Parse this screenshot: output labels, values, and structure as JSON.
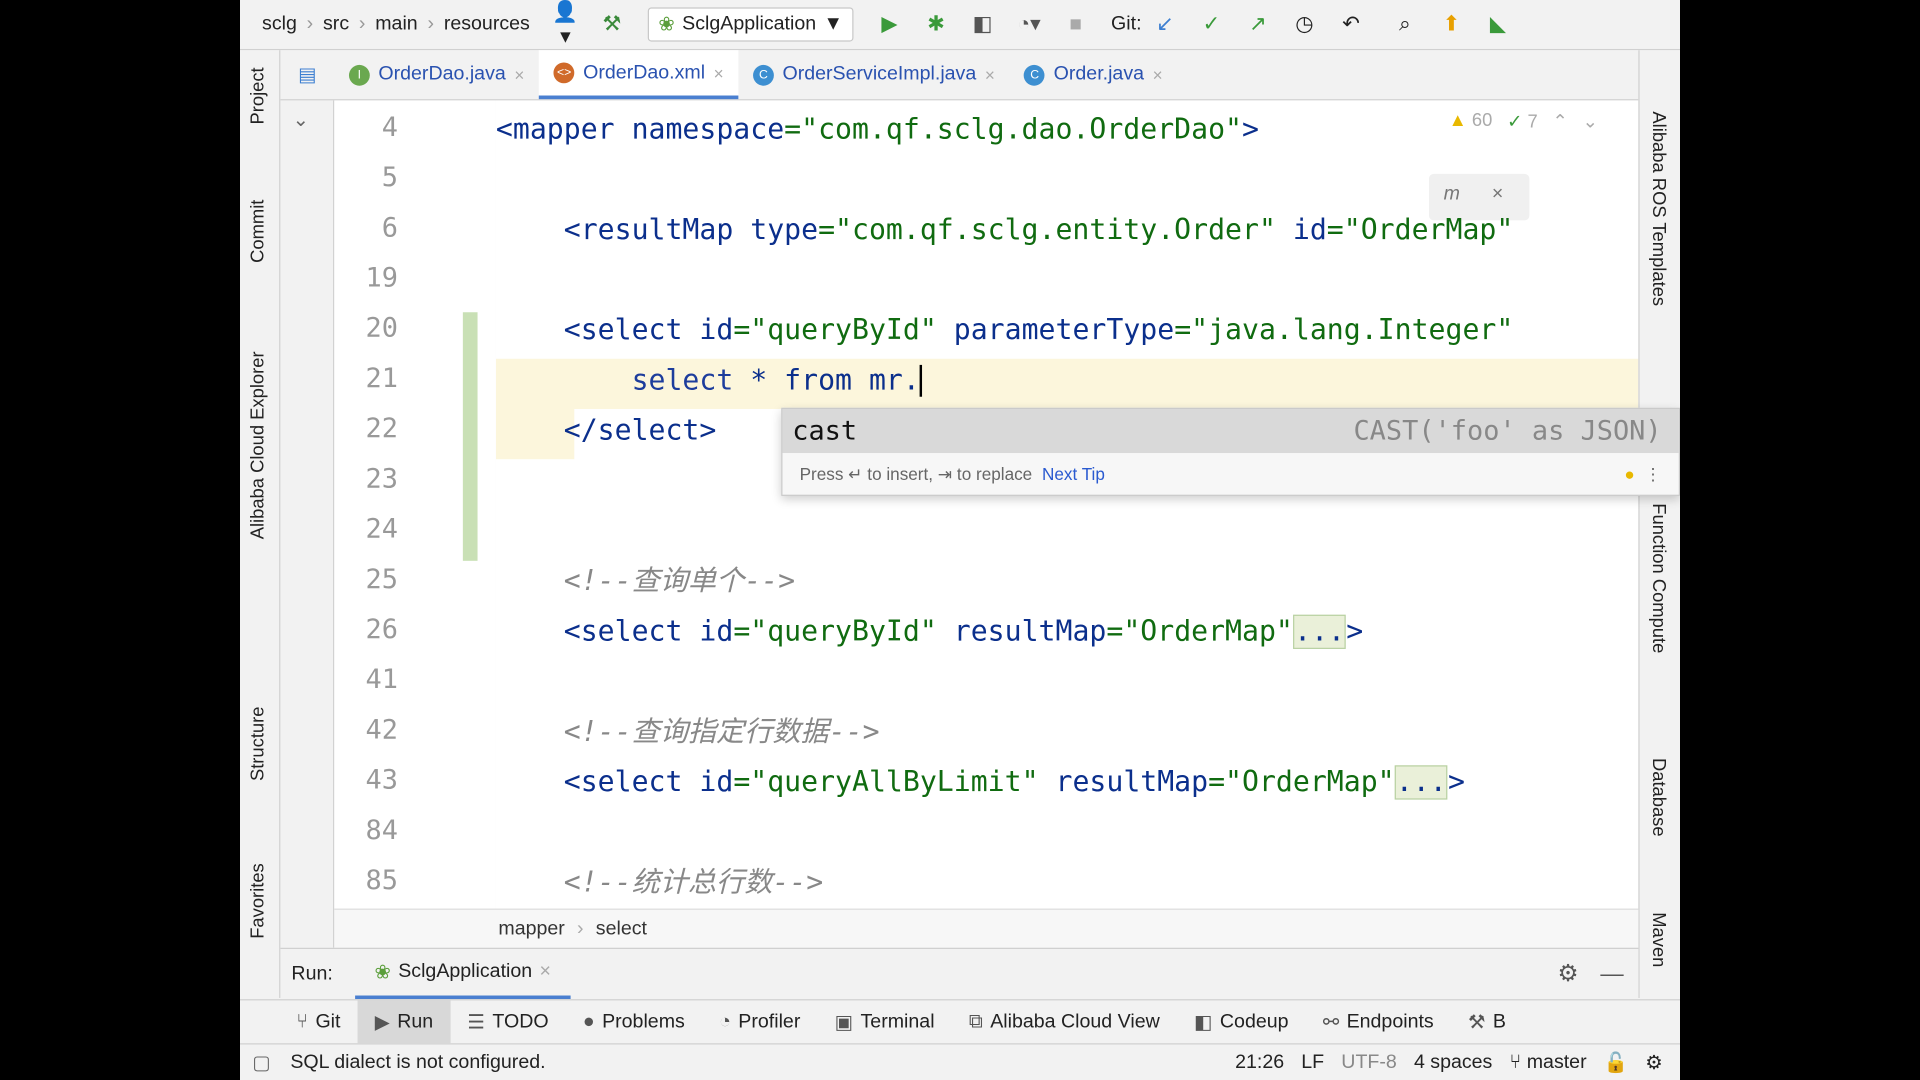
{
  "toolbar": {
    "breadcrumb": [
      "sclg",
      "src",
      "main",
      "resources"
    ],
    "run_config": "SclgApplication",
    "git_label": "Git:"
  },
  "tabs": [
    {
      "label": "OrderDao.java",
      "badge": "I",
      "color": "#6aa84f"
    },
    {
      "label": "OrderDao.xml",
      "badge": "xml",
      "color": "#d06a2a",
      "active": true
    },
    {
      "label": "OrderServiceImpl.java",
      "badge": "C",
      "color": "#3d8fd1"
    },
    {
      "label": "Order.java",
      "badge": "C",
      "color": "#3d8fd1"
    }
  ],
  "left_tools": [
    "Project",
    "Commit",
    "Alibaba Cloud Explorer",
    "Structure",
    "Favorites"
  ],
  "right_tools": [
    "Alibaba ROS Templates",
    "Function Compute",
    "Database",
    "Maven"
  ],
  "inspections": {
    "warnings": "60",
    "ok": "7"
  },
  "lines": [
    {
      "num": "4",
      "html": "<span class='t'>&lt;mapper </span><span class='a'>namespace</span><span class='s'>=\"com.qf.sclg.dao.OrderDao\"</span><span class='t'>&gt;</span>"
    },
    {
      "num": "5",
      "html": ""
    },
    {
      "num": "6",
      "html": "    <span class='t'>&lt;resultMap </span><span class='a'>type</span><span class='s'>=\"com.qf.sclg.entity.Order\"</span> <span class='a'>id</span><span class='s'>=\"OrderMap\"</span>"
    },
    {
      "num": "19",
      "html": ""
    },
    {
      "num": "20",
      "html": "    <span class='t'>&lt;select </span><span class='a'>id</span><span class='s'>=\"queryById\"</span> <span class='a'>parameterType</span><span class='s'>=\"java.lang.Integer\"</span>"
    },
    {
      "num": "21",
      "html": "        <span class='k'>select</span> * from mr.|"
    },
    {
      "num": "22",
      "html": "    <span class='t'>&lt;/select&gt;</span>"
    },
    {
      "num": "23",
      "html": ""
    },
    {
      "num": "24",
      "html": ""
    },
    {
      "num": "25",
      "html": "    <span class='c'>&lt;!--查询单个--&gt;</span>"
    },
    {
      "num": "26",
      "html": "    <span class='t'>&lt;select </span><span class='a'>id</span><span class='s'>=\"queryById\"</span> <span class='a'>resultMap</span><span class='s'>=\"OrderMap\"</span><span class='fold'>...</span><span class='t'>&gt;</span>"
    },
    {
      "num": "41",
      "html": ""
    },
    {
      "num": "42",
      "html": "    <span class='c'>&lt;!--查询指定行数据--&gt;</span>"
    },
    {
      "num": "43",
      "html": "    <span class='t'>&lt;select </span><span class='a'>id</span><span class='s'>=\"queryAllByLimit\"</span> <span class='a'>resultMap</span><span class='s'>=\"OrderMap\"</span><span class='fold'>...</span><span class='t'>&gt;</span>"
    },
    {
      "num": "84",
      "html": ""
    },
    {
      "num": "85",
      "html": "    <span class='c'>&lt;!--统计总行数--&gt;</span>"
    }
  ],
  "completion": {
    "item": "cast",
    "detail": "CAST('foo' as JSON)",
    "hint": "Press ↵ to insert, ⇥ to replace",
    "next_tip": "Next Tip"
  },
  "editor_breadcrumb": [
    "mapper",
    "select"
  ],
  "run": {
    "label": "Run:",
    "config": "SclgApplication"
  },
  "bottom_tabs": [
    {
      "icon": "⑂",
      "label": "Git"
    },
    {
      "icon": "▶",
      "label": "Run",
      "active": true
    },
    {
      "icon": "☰",
      "label": "TODO"
    },
    {
      "icon": "●",
      "label": "Problems"
    },
    {
      "icon": "◔",
      "label": "Profiler"
    },
    {
      "icon": "▣",
      "label": "Terminal"
    },
    {
      "icon": "⧉",
      "label": "Alibaba Cloud View"
    },
    {
      "icon": "◧",
      "label": "Codeup"
    },
    {
      "icon": "⚯",
      "label": "Endpoints"
    },
    {
      "icon": "⚒",
      "label": "B"
    }
  ],
  "status": {
    "message": "SQL dialect is not configured.",
    "position": "21:26",
    "line_sep": "LF",
    "encoding": "UTF-8",
    "indent": "4 spaces",
    "branch": "master"
  }
}
